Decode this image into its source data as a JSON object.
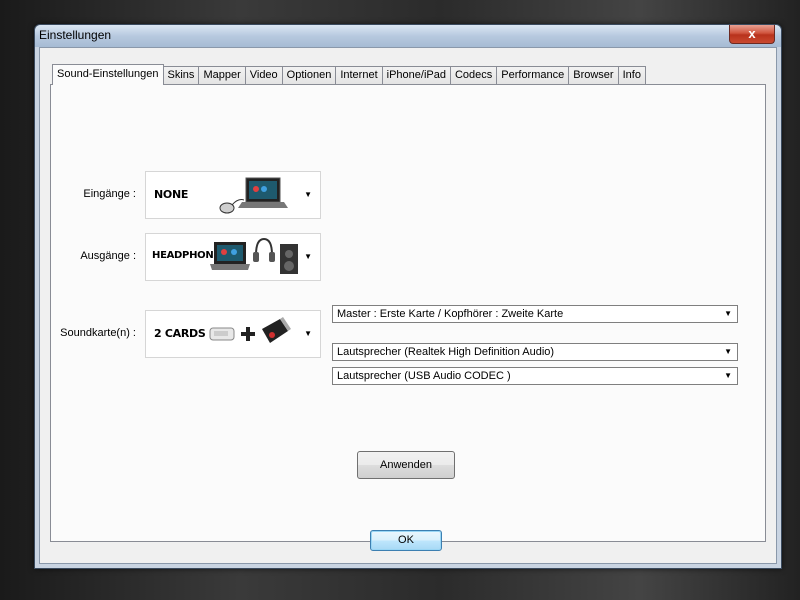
{
  "window": {
    "title": "Einstellungen",
    "close_label": "x"
  },
  "tabs": [
    {
      "label": "Sound-Einstellungen",
      "active": true
    },
    {
      "label": "Skins"
    },
    {
      "label": "Mapper"
    },
    {
      "label": "Video"
    },
    {
      "label": "Optionen"
    },
    {
      "label": "Internet"
    },
    {
      "label": "iPhone/iPad"
    },
    {
      "label": "Codecs"
    },
    {
      "label": "Performance"
    },
    {
      "label": "Browser"
    },
    {
      "label": "Info"
    }
  ],
  "inputs": {
    "label": "Eingänge :",
    "selection": "NONE"
  },
  "outputs": {
    "label": "Ausgänge :",
    "selection": "HEADPHONES",
    "routing": "Master : Erste Karte / Kopfhörer : Zweite Karte"
  },
  "soundcards": {
    "label": "Soundkarte(n) :",
    "selection": "2 CARDS",
    "card1": "Lautsprecher (Realtek High Definition Audio)",
    "card2": "Lautsprecher (USB Audio CODEC )"
  },
  "apply_label": "Anwenden",
  "ok_label": "OK",
  "icons": {
    "dropdown": "chevron-down-icon",
    "laptop": "laptop-icon",
    "mouse": "mouse-icon",
    "headphones": "headphones-icon",
    "speaker": "speaker-icon",
    "soundcard": "soundcard-icon",
    "usb": "usb-stick-icon",
    "plus": "plus-icon"
  }
}
